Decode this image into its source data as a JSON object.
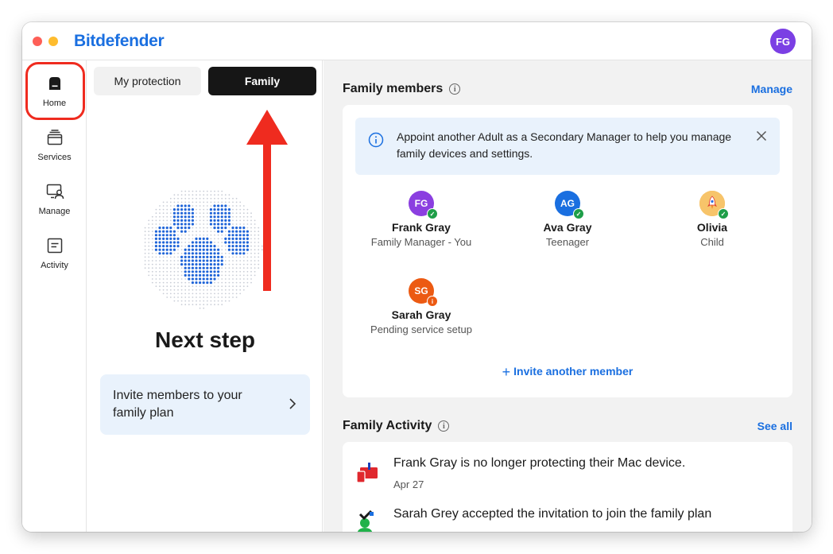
{
  "app": {
    "brand": "Bitdefender",
    "user_initials": "FG"
  },
  "nav": [
    {
      "id": "home",
      "label": "Home",
      "icon": "home-icon"
    },
    {
      "id": "services",
      "label": "Services",
      "icon": "services-icon"
    },
    {
      "id": "manage",
      "label": "Manage",
      "icon": "manage-devices-icon"
    },
    {
      "id": "activity",
      "label": "Activity",
      "icon": "activity-icon"
    }
  ],
  "tabs": {
    "my_protection": "My protection",
    "family": "Family"
  },
  "left": {
    "next_step": "Next step",
    "invite_card": "Invite members to your family plan"
  },
  "family_members": {
    "title": "Family members",
    "manage_link": "Manage",
    "banner": "Appoint another Adult as a Secondary Manager to help you manage family devices and settings.",
    "members": [
      {
        "initials": "FG",
        "name": "Frank Gray",
        "role": "Family Manager - You",
        "avatar_color": "#8b3fe0",
        "status": "verified"
      },
      {
        "initials": "AG",
        "name": "Ava Gray",
        "role": "Teenager",
        "avatar_color": "#1a6fe0",
        "status": "verified"
      },
      {
        "initials": "",
        "name": "Olivia",
        "role": "Child",
        "avatar_color": "#f5b04a",
        "status": "verified"
      },
      {
        "initials": "SG",
        "name": "Sarah Gray",
        "role": "Pending service setup",
        "avatar_color": "#ec5a12",
        "status": "pending"
      }
    ],
    "invite_link": "Invite another member"
  },
  "family_activity": {
    "title": "Family Activity",
    "see_all": "See all",
    "items": [
      {
        "text": "Frank Gray is no longer protecting their Mac device.",
        "date": "Apr 27"
      },
      {
        "text": "Sarah Grey accepted the invitation to join the family plan",
        "date": ""
      }
    ]
  },
  "colors": {
    "accent": "#1a6fe0",
    "annotation": "#ef2b1f",
    "verified": "#1e9e48",
    "pending": "#ec5a12"
  }
}
